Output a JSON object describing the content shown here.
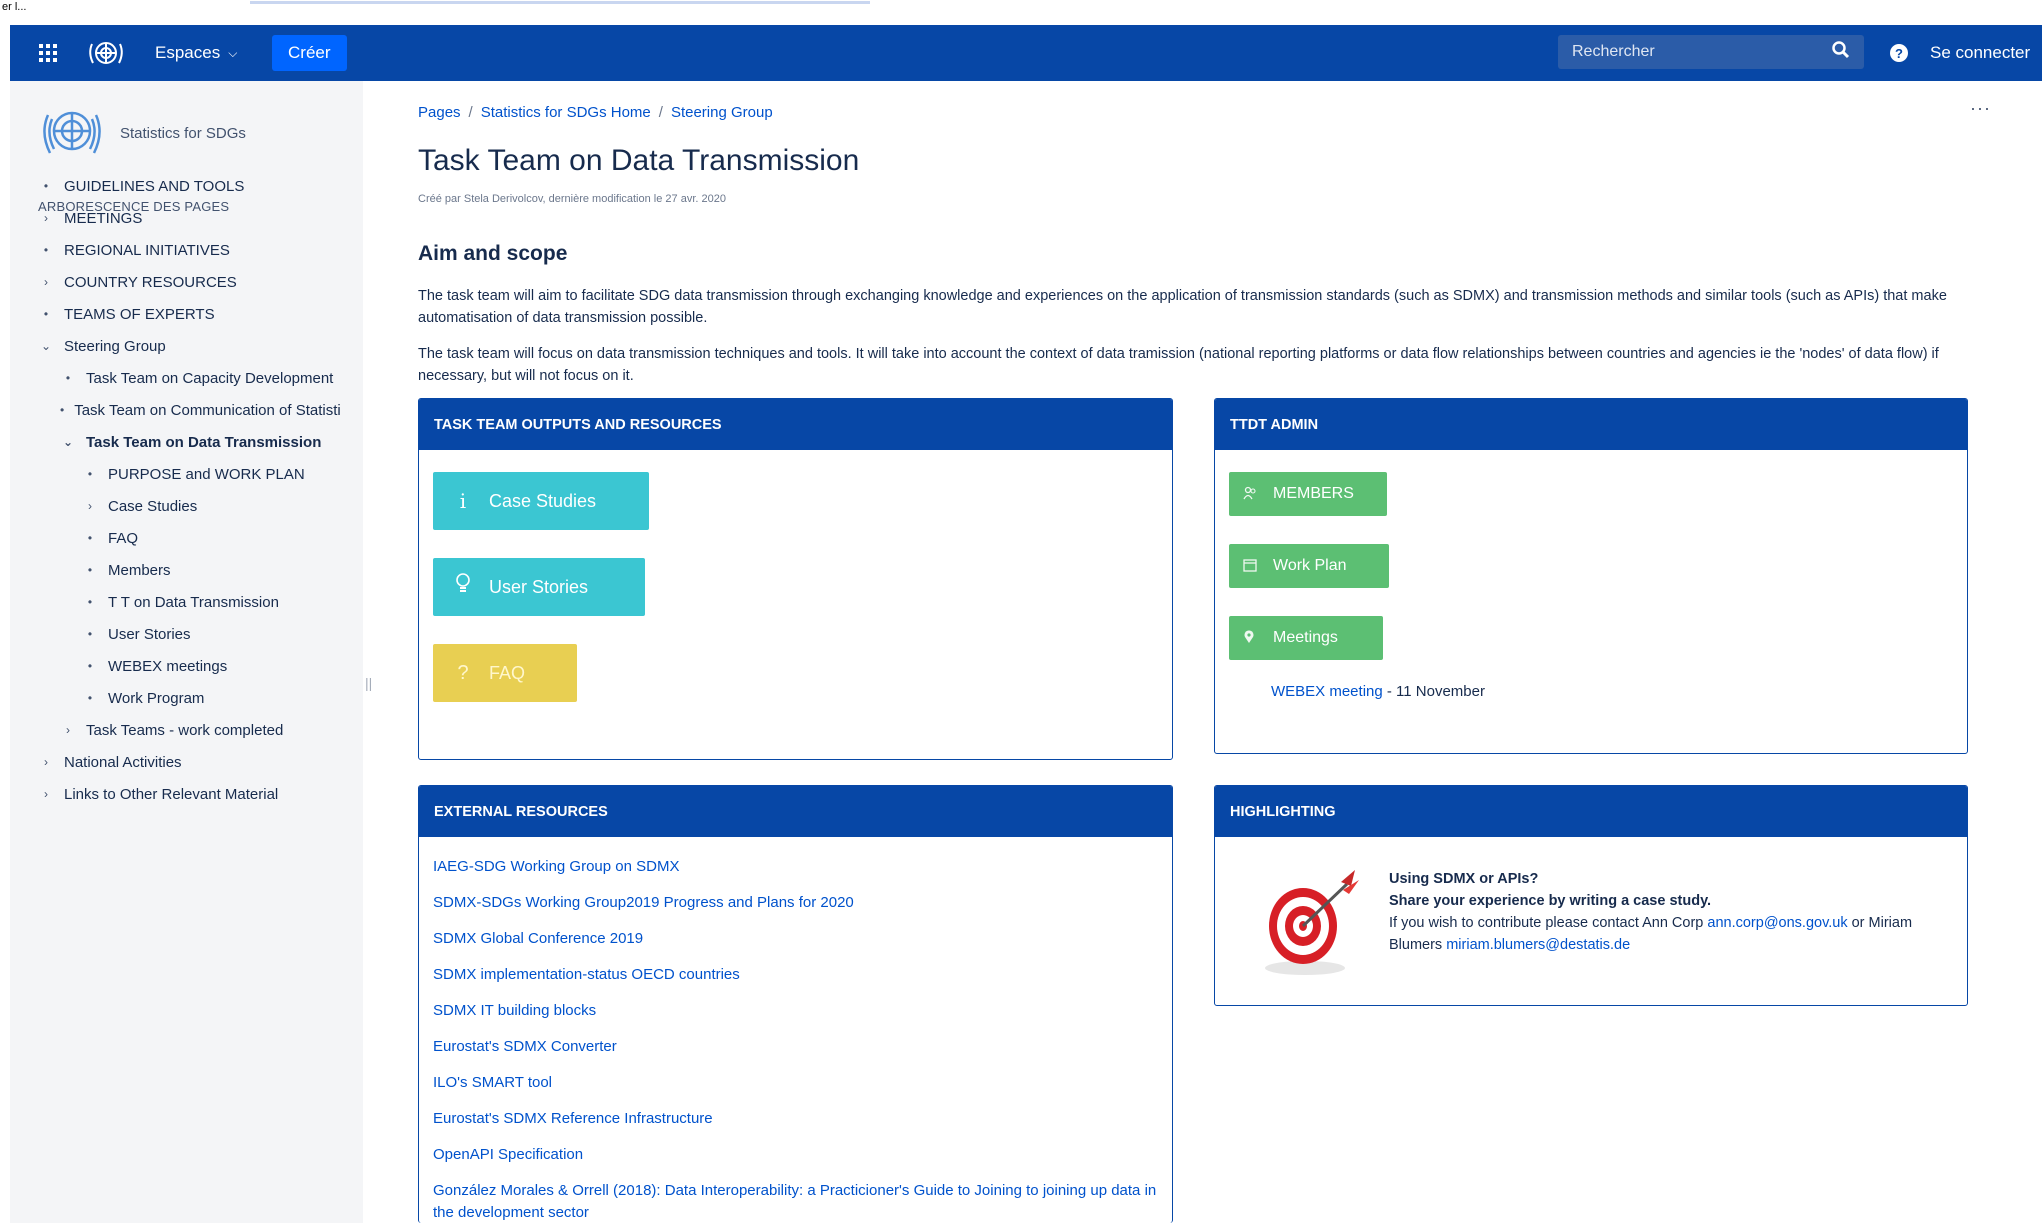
{
  "tiny_top": "er l...",
  "topbar": {
    "spaces_label": "Espaces",
    "create_label": "Créer",
    "search_placeholder": "Rechercher",
    "login_label": "Se connecter"
  },
  "sidebar": {
    "space_name": "Statistics for SDGs",
    "tree_title": "ARBORESCENCE DES PAGES",
    "items": [
      {
        "label": "GUIDELINES AND TOOLS",
        "marker": "•"
      },
      {
        "label": "MEETINGS",
        "marker": "›"
      },
      {
        "label": "REGIONAL INITIATIVES",
        "marker": "•"
      },
      {
        "label": "COUNTRY RESOURCES",
        "marker": "›"
      },
      {
        "label": "TEAMS OF EXPERTS",
        "marker": "•"
      },
      {
        "label": "Steering Group",
        "marker": "⌄"
      },
      {
        "label": "Task Team on Capacity Development",
        "marker": "•"
      },
      {
        "label": "Task Team on Communication of Statistics",
        "marker": "•"
      },
      {
        "label": "Task Team on Data Transmission",
        "marker": "⌄"
      },
      {
        "label": "PURPOSE and WORK PLAN",
        "marker": "•"
      },
      {
        "label": "Case Studies",
        "marker": "›"
      },
      {
        "label": "FAQ",
        "marker": "•"
      },
      {
        "label": "Members",
        "marker": "•"
      },
      {
        "label": "T T on Data Transmission",
        "marker": "•"
      },
      {
        "label": "User Stories",
        "marker": "•"
      },
      {
        "label": "WEBEX meetings",
        "marker": "•"
      },
      {
        "label": "Work Program",
        "marker": "•"
      },
      {
        "label": "Task Teams - work completed",
        "marker": "›"
      },
      {
        "label": "National Activities",
        "marker": "›"
      },
      {
        "label": "Links to Other Relevant Material",
        "marker": "›"
      }
    ]
  },
  "breadcrumb": [
    "Pages",
    "Statistics for SDGs Home",
    "Steering Group"
  ],
  "breadcrumb_sep": "/",
  "more_menu": "···",
  "page": {
    "title": "Task Team on Data Transmission",
    "byline": "Créé par Stela Derivolcov, dernière modification le 27 avr. 2020",
    "aim_heading": "Aim and scope",
    "para1": "The task team will aim to facilitate SDG data transmission through exchanging knowledge and experiences on the application of transmission standards (such as SDMX) and transmission methods and similar tools (such as APIs) that make automatisation of data transmission possible.",
    "para2": "The task team will focus on data transmission techniques and tools. It will take into account the context of data tramission (national reporting platforms or data flow relationships between countries and agencies ie the 'nodes' of data flow) if necessary, but will not focus on it."
  },
  "outputs_panel": {
    "title": "TASK TEAM OUTPUTS AND RESOURCES",
    "case_studies": "Case Studies",
    "user_stories": "User Stories",
    "faq": "FAQ",
    "case_icon": "i",
    "stories_icon": "💡",
    "faq_icon": "?"
  },
  "admin_panel": {
    "title": "TTDT ADMIN",
    "members": "MEMBERS",
    "work_plan": "Work Plan",
    "meetings": "Meetings",
    "webex_link": "WEBEX meeting",
    "webex_suffix": " - 11 November"
  },
  "external_panel": {
    "title": "EXTERNAL RESOURCES",
    "links": [
      "IAEG-SDG Working Group on SDMX",
      "SDMX-SDGs Working Group2019 Progress and Plans for 2020",
      "SDMX Global Conference 2019",
      "SDMX implementation-status OECD countries",
      "SDMX IT building blocks",
      "Eurostat's SDMX Converter",
      "ILO's SMART tool",
      "Eurostat's SDMX Reference Infrastructure",
      "OpenAPI Specification",
      "González Morales & Orrell (2018): Data Interoperability: a Practicioner's Guide to Joining to joining up data in the development sector"
    ]
  },
  "highlight_panel": {
    "title": "HIGHLIGHTING",
    "line1": "Using SDMX or APIs?",
    "line2": "Share your experience by writing a case study.",
    "line3_pre": "If you wish to contribute please contact Ann Corp ",
    "email1": "ann.corp@ons.gov.uk",
    "line3_mid": " or Miriam Blumers ",
    "email2": "miriam.blumers@destatis.de"
  },
  "colors": {
    "topbar": "#0747a6",
    "create_button": "#0065ff",
    "link": "#0052cc",
    "teal_tile": "#3bc6d2",
    "yellow_tile": "#e8cf52",
    "green_button": "#5cbf73"
  }
}
